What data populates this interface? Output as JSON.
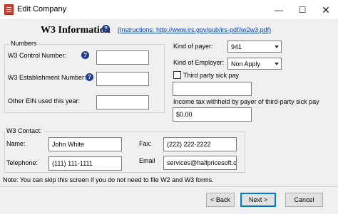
{
  "window": {
    "title": "Edit Company",
    "minimize": "—",
    "maximize": "☐",
    "close": "✕"
  },
  "header": {
    "title": "W3 Information",
    "help": "?",
    "instructions_link": "(Instructions: http://www.irs.gov/pub/irs-pdf/iw2w3.pdf)"
  },
  "numbers": {
    "legend": "Numbers",
    "control_number_label": "W3 Control Number:",
    "control_number_value": "",
    "establishment_number_label": "W3 Establishment Number:",
    "establishment_number_value": "",
    "other_ein_label": "Other EIN used this year:",
    "other_ein_value": ""
  },
  "payer": {
    "kind_of_payer_label": "Kind of payer:",
    "kind_of_payer_value": "941",
    "kind_of_employer_label": "Kind of Employer:",
    "kind_of_employer_value": "Non Apply",
    "third_party_label": "Third party sick pay",
    "third_party_checked": false,
    "third_party_value": "",
    "income_tax_label": "Income tax withheld by payer of third-party sick pay",
    "income_tax_value": "$0.00"
  },
  "contact": {
    "legend": "W3 Contact:",
    "name_label": "Name:",
    "name_value": "John White",
    "fax_label": "Fax:",
    "fax_value": "(222) 222-2222",
    "telephone_label": "Telephone:",
    "telephone_value": "(111) 111-1111",
    "email_label": "Email",
    "email_value": "services@halfpricesoft.cc"
  },
  "note": "Note: You can skip this screen if you do not need to file W2 and W3 forms.",
  "buttons": {
    "back": "< Back",
    "next": "Next >",
    "cancel": "Cancel"
  }
}
